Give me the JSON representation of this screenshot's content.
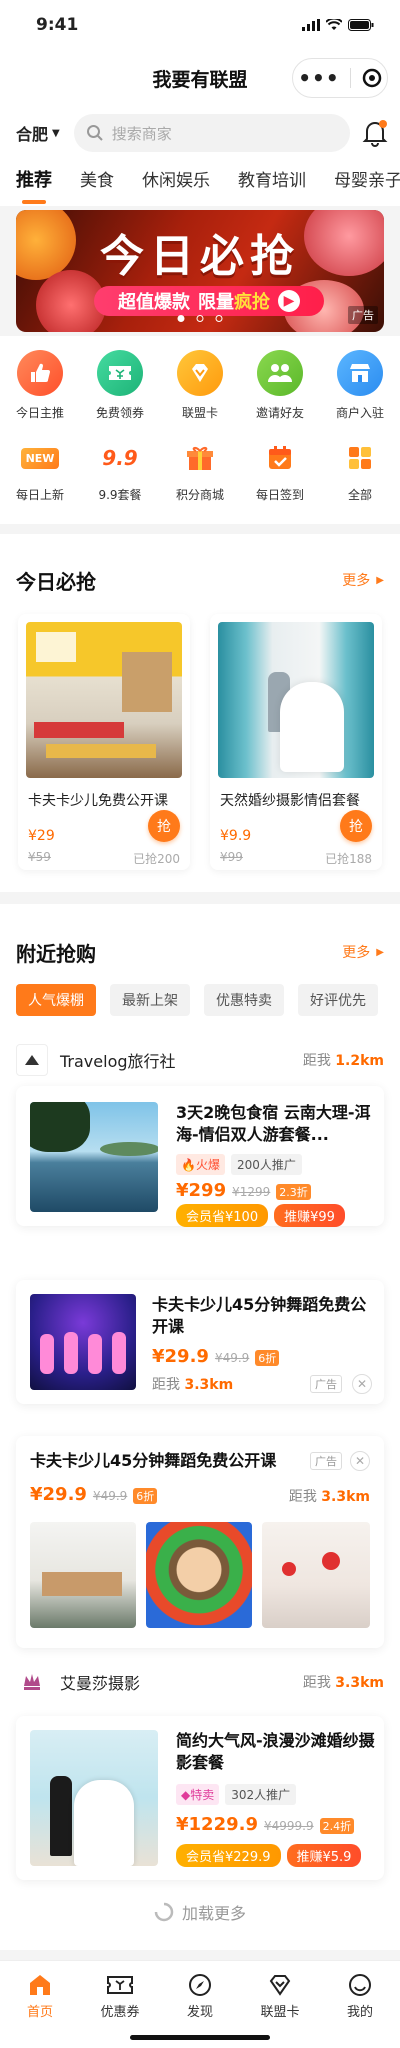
{
  "status": {
    "time": "9:41"
  },
  "nav": {
    "title": "我要有联盟"
  },
  "search": {
    "city": "合肥",
    "placeholder": "搜索商家"
  },
  "tabs": [
    "推荐",
    "美食",
    "休闲娱乐",
    "教育培训",
    "母婴亲子"
  ],
  "banner": {
    "title": "今日必抢",
    "sub_a": "超值爆款",
    "sub_b": "限量",
    "sub_c": "疯抢",
    "ad": "广告"
  },
  "grid": [
    {
      "label": "今日主推",
      "color": "#ff6a3d"
    },
    {
      "label": "免费领券",
      "color": "#2ec98a"
    },
    {
      "label": "联盟卡",
      "color": "#ffae1a"
    },
    {
      "label": "邀请好友",
      "color": "#7ac943"
    },
    {
      "label": "商户入驻",
      "color": "#3aa3ff"
    },
    {
      "label": "每日上新",
      "icon_text": "NEW"
    },
    {
      "label": "9.9套餐",
      "icon_text": "9.9"
    },
    {
      "label": "积分商城"
    },
    {
      "label": "每日签到"
    },
    {
      "label": "全部"
    }
  ],
  "today": {
    "title": "今日必抢",
    "more": "更多",
    "items": [
      {
        "name": "卡夫卡少儿免费公开课",
        "price": "¥29",
        "orig": "¥59",
        "btn": "抢",
        "sold": "已抢200"
      },
      {
        "name": "天然婚纱摄影情侣套餐",
        "price": "¥9.9",
        "orig": "¥99",
        "btn": "抢",
        "sold": "已抢188"
      }
    ]
  },
  "nearby": {
    "title": "附近抢购",
    "more": "更多",
    "filters": [
      "人气爆棚",
      "最新上架",
      "优惠特卖",
      "好评优先"
    ]
  },
  "m1": {
    "name": "Travelog旅行社",
    "dist_label": "距我",
    "dist": "1.2km"
  },
  "p1": {
    "title": "3天2晚包食宿 云南大理-洱海-情侣双人游套餐...",
    "tag_hot": "火爆",
    "promo": "200人推广",
    "price": "¥299",
    "orig": "¥1299",
    "disc": "2.3折",
    "member": "会员省¥100",
    "earn": "推赚¥99"
  },
  "p2": {
    "title": "卡夫卡少儿45分钟舞蹈免费公开课",
    "price": "¥29.9",
    "orig": "¥49.9",
    "disc": "6折",
    "dist_label": "距我",
    "dist": "3.3km",
    "ad": "广告"
  },
  "p3": {
    "title": "卡夫卡少儿45分钟舞蹈免费公开课",
    "ad": "广告",
    "price": "¥29.9",
    "orig": "¥49.9",
    "disc": "6折",
    "dist_label": "距我",
    "dist": "3.3km"
  },
  "m2": {
    "name": "艾曼莎摄影",
    "dist_label": "距我",
    "dist": "3.3km"
  },
  "p4": {
    "title": "简约大气风-浪漫沙滩婚纱摄影套餐",
    "tag_hot": "特卖",
    "promo": "302人推广",
    "price": "¥1229.9",
    "orig": "¥4999.9",
    "disc": "2.4折",
    "member": "会员省¥229.9",
    "earn": "推赚¥5.9"
  },
  "loadmore": "加载更多",
  "tabbar": [
    "首页",
    "优惠券",
    "发现",
    "联盟卡",
    "我的"
  ],
  "colors": {
    "accent": "#ff7a1a",
    "price": "#ff6a00"
  }
}
